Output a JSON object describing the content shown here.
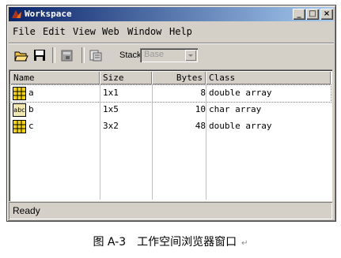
{
  "window": {
    "title": "Workspace",
    "controls": {
      "minimize": "_",
      "maximize": "□",
      "close": "×"
    }
  },
  "menu": {
    "items": [
      "File",
      "Edit",
      "View",
      "Web",
      "Window",
      "Help"
    ]
  },
  "toolbar": {
    "icons": [
      "open-folder-icon",
      "save-icon",
      "import-icon",
      "workspace-browser-icon"
    ],
    "stack_label": "Stack:",
    "stack_value": "Base"
  },
  "table": {
    "columns": [
      "Name",
      "Size",
      "Bytes",
      "Class"
    ],
    "rows": [
      {
        "icon": "numeric-array-icon",
        "name": "a",
        "size": "1x1",
        "bytes": "8",
        "class": "double array"
      },
      {
        "icon": "char-array-icon",
        "icon_text": "abc",
        "name": "b",
        "size": "1x5",
        "bytes": "10",
        "class": "char array"
      },
      {
        "icon": "numeric-array-icon",
        "name": "c",
        "size": "3x2",
        "bytes": "48",
        "class": "double array"
      }
    ]
  },
  "status": {
    "text": "Ready"
  },
  "caption": {
    "text": "图 A-3　工作空间浏览器窗口",
    "mark": "↵"
  },
  "colors": {
    "titlebar_start": "#0a246a",
    "titlebar_end": "#a6caf0",
    "chrome": "#d4d0c8",
    "grid_icon": "#f5d400"
  }
}
